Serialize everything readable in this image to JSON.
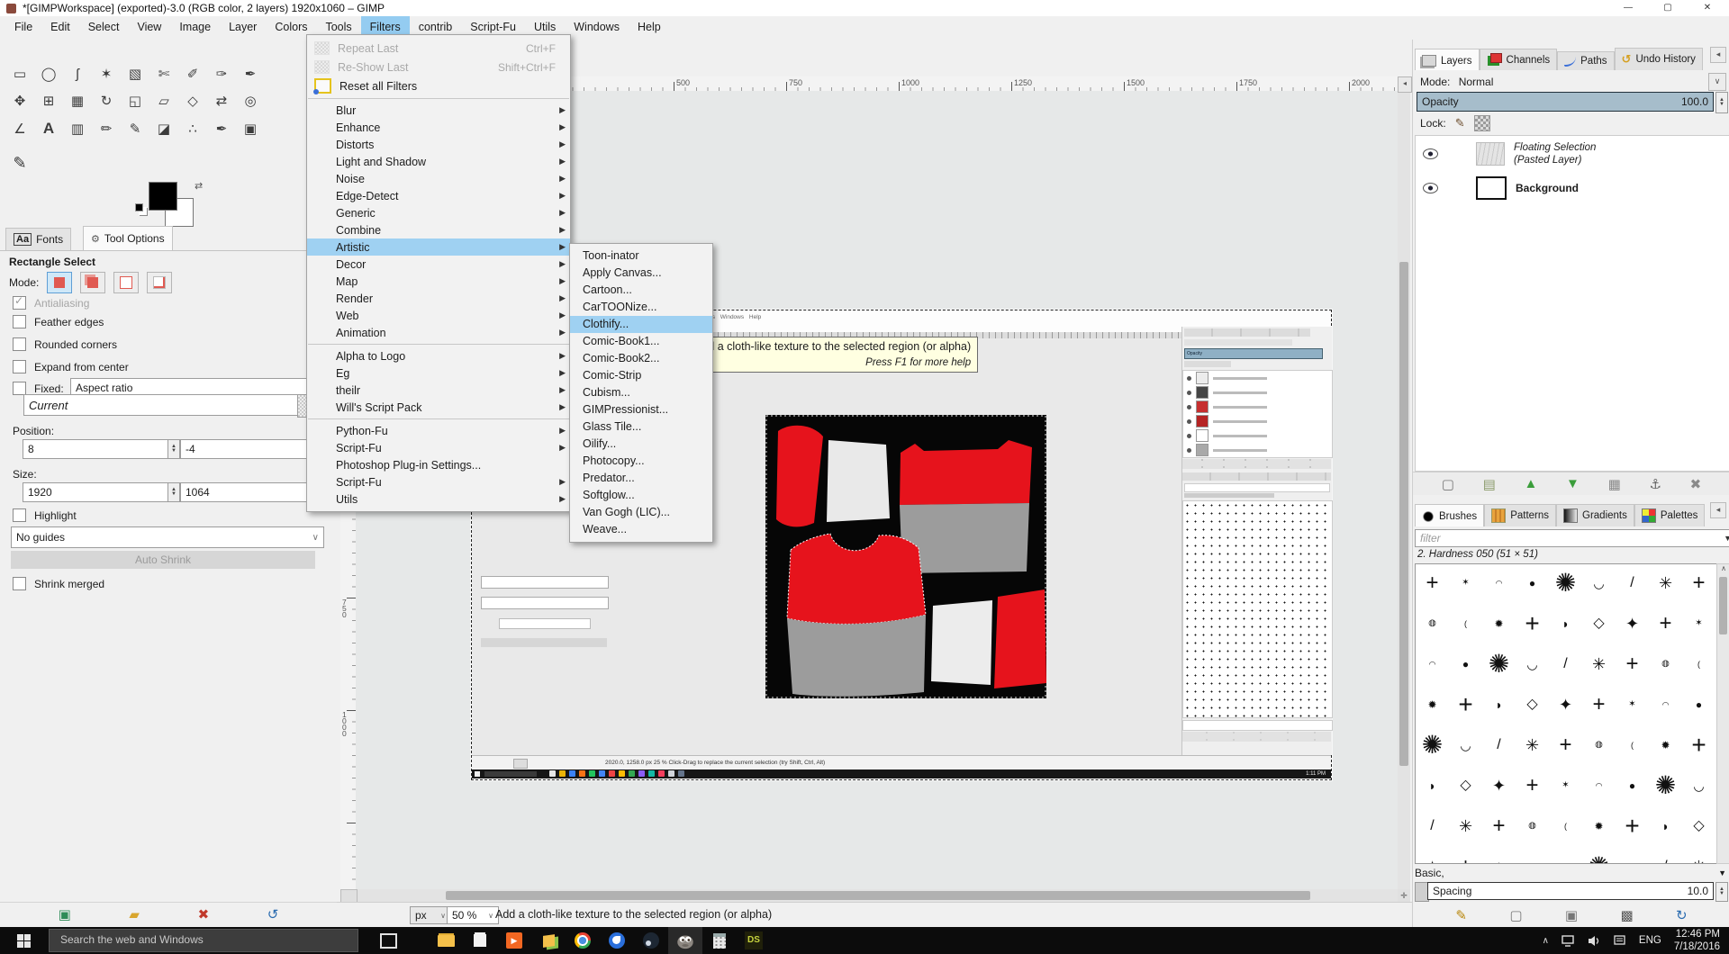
{
  "titlebar": {
    "title": "*[GIMPWorkspace] (exported)-3.0 (RGB color, 2 layers) 1920x1060 – GIMP",
    "buttons": {
      "minimize": "—",
      "maximize": "▢",
      "close": "✕"
    }
  },
  "menubar": {
    "items": [
      "File",
      "Edit",
      "Select",
      "View",
      "Image",
      "Layer",
      "Colors",
      "Tools",
      "Filters",
      "contrib",
      "Script-Fu",
      "Utils",
      "Windows",
      "Help"
    ],
    "active_index": 8
  },
  "filters_menu": {
    "items": [
      {
        "label": "Repeat Last",
        "shortcut": "Ctrl+F",
        "disabled": true,
        "icon": "pattern",
        "tall": true
      },
      {
        "label": "Re-Show Last",
        "shortcut": "Shift+Ctrl+F",
        "disabled": true,
        "icon": "pattern",
        "tall": true
      },
      {
        "label": "Reset all Filters",
        "icon": "reset",
        "tall": true
      },
      {
        "sep": true
      },
      {
        "label": "Blur",
        "sub": true
      },
      {
        "label": "Enhance",
        "sub": true
      },
      {
        "label": "Distorts",
        "sub": true
      },
      {
        "label": "Light and Shadow",
        "sub": true
      },
      {
        "label": "Noise",
        "sub": true
      },
      {
        "label": "Edge-Detect",
        "sub": true
      },
      {
        "label": "Generic",
        "sub": true
      },
      {
        "label": "Combine",
        "sub": true
      },
      {
        "label": "Artistic",
        "sub": true,
        "hl": true
      },
      {
        "label": "Decor",
        "sub": true
      },
      {
        "label": "Map",
        "sub": true
      },
      {
        "label": "Render",
        "sub": true
      },
      {
        "label": "Web",
        "sub": true
      },
      {
        "label": "Animation",
        "sub": true
      },
      {
        "sep": true
      },
      {
        "label": "Alpha to Logo",
        "sub": true
      },
      {
        "label": "Eg",
        "sub": true
      },
      {
        "label": "theilr",
        "sub": true
      },
      {
        "label": "Will's Script Pack",
        "sub": true
      },
      {
        "sep": true
      },
      {
        "label": "Python-Fu",
        "sub": true
      },
      {
        "label": "Script-Fu",
        "sub": true
      },
      {
        "label": "Photoshop Plug-in Settings..."
      },
      {
        "label": "Script-Fu",
        "sub": true
      },
      {
        "label": "Utils",
        "sub": true
      }
    ]
  },
  "artistic_submenu": {
    "highlighted": "Clothify...",
    "items": [
      "Toon-inator",
      "Apply Canvas...",
      "Cartoon...",
      "CarTOONize...",
      "Clothify...",
      "Comic-Book1...",
      "Comic-Book2...",
      "Comic-Strip",
      "Cubism...",
      "GIMPressionist...",
      "Glass Tile...",
      "Oilify...",
      "Photocopy...",
      "Predator...",
      "Softglow...",
      "Van Gogh (LIC)...",
      "Weave..."
    ]
  },
  "tooltip": {
    "line1": "Add a cloth-like texture to the selected region (or alpha)",
    "line2": "Press F1 for more help"
  },
  "toolbox": {
    "tools": [
      {
        "name": "rectangle-select",
        "glyph": "▭"
      },
      {
        "name": "ellipse-select",
        "glyph": "◯"
      },
      {
        "name": "free-select",
        "glyph": "ʃ"
      },
      {
        "name": "fuzzy-select",
        "glyph": "✶"
      },
      {
        "name": "select-by-color",
        "glyph": "▧"
      },
      {
        "name": "scissors-select",
        "glyph": "✄"
      },
      {
        "name": "foreground-select",
        "glyph": "✐"
      },
      {
        "name": "paths",
        "glyph": "✑"
      },
      {
        "name": "color-picker",
        "glyph": "✒"
      },
      {
        "name": "move",
        "glyph": "✥"
      },
      {
        "name": "alignment",
        "glyph": "⊞"
      },
      {
        "name": "crop",
        "glyph": "▦"
      },
      {
        "name": "rotate",
        "glyph": "↻"
      },
      {
        "name": "scale",
        "glyph": "◱"
      },
      {
        "name": "shear",
        "glyph": "▱"
      },
      {
        "name": "perspective",
        "glyph": "◇"
      },
      {
        "name": "flip",
        "glyph": "⇄"
      },
      {
        "name": "zoom",
        "glyph": "◎"
      },
      {
        "name": "measure",
        "glyph": "∠"
      },
      {
        "name": "text",
        "glyph": "A"
      },
      {
        "name": "gradient",
        "glyph": "▥"
      },
      {
        "name": "pencil",
        "glyph": "✏"
      },
      {
        "name": "paintbrush",
        "glyph": "✎"
      },
      {
        "name": "eraser",
        "glyph": "◪"
      },
      {
        "name": "airbrush",
        "glyph": "∴"
      },
      {
        "name": "ink",
        "glyph": "✒"
      },
      {
        "name": "clone",
        "glyph": "▣"
      }
    ],
    "paint_tool_glyph": "✎"
  },
  "tool_options": {
    "fonts_tab_icon": "Aa",
    "fonts_tab": "Fonts",
    "tool_options_tab": "Tool Options",
    "title": "Rectangle Select",
    "mode_label": "Mode:",
    "antialiasing_label": "Antialiasing",
    "feather_label": "Feather edges",
    "rounded_label": "Rounded corners",
    "expand_label": "Expand from center",
    "fixed_label": "Fixed:",
    "fixed_value": "Aspect ratio",
    "current_value": "Current",
    "position_label": "Position:",
    "position_x": "8",
    "position_y": "-4",
    "size_label": "Size:",
    "size_w": "1920",
    "size_h": "1064",
    "highlight_label": "Highlight",
    "guides_value": "No guides",
    "auto_shrink_label": "Auto Shrink",
    "shrink_merged_label": "Shrink merged"
  },
  "left_dock_footer": {
    "icons": [
      {
        "name": "save-preset-icon",
        "glyph": "▣",
        "color": "#2e8b57"
      },
      {
        "name": "open-folder-icon",
        "glyph": "▰",
        "color": "#d9a62e"
      },
      {
        "name": "delete-preset-icon",
        "glyph": "✖",
        "color": "#c0392b"
      },
      {
        "name": "reset-tool-icon",
        "glyph": "↺",
        "color": "#2b6cb0"
      }
    ]
  },
  "canvas": {
    "h_ruler_labels": [
      500,
      750,
      1000,
      1250,
      1500,
      1750,
      2000
    ],
    "v_ruler_labels": [
      750,
      1000
    ],
    "statusbar": {
      "unit": "px",
      "zoom": "50 %",
      "message": "Add a cloth-like texture to the selected region (or alpha)"
    }
  },
  "inner_screenshot": {
    "menu_text": "File   Edit   Select   View   Image   Layer   Colors   Tools   Filters   contrib   Script-Fu   Utils   Windows   Help",
    "status_text": "2020.0, 1258.0      px      25 %      Click-Drag to replace the current selection (try Shift, Ctrl, Alt)",
    "clock": "1:11 PM",
    "taskbar_colors": [
      "#e6e6e6",
      "#eab308",
      "#3b82f6",
      "#f97316",
      "#22c55e",
      "#4285f4",
      "#ef4444",
      "#fbbc05",
      "#34a853",
      "#8b5cf6",
      "#14b8a6",
      "#f43f5e",
      "#d1d5db",
      "#64748b"
    ],
    "layer_thumbs": [
      "#ececec",
      "#454545",
      "#c62f2f",
      "#b52424",
      "#ffffff",
      "#a9a9a9"
    ]
  },
  "layers_panel": {
    "tabs": [
      "Layers",
      "Channels",
      "Paths",
      "Undo History"
    ],
    "mode_label": "Mode:",
    "mode_value": "Normal",
    "opacity_label": "Opacity",
    "opacity_value": "100.0",
    "lock_label": "Lock:",
    "layer1_line1": "Floating Selection",
    "layer1_line2": "(Pasted Layer)",
    "layer2": "Background",
    "footer_icons": [
      {
        "name": "new-layer-icon",
        "glyph": "▢",
        "color": "#777777"
      },
      {
        "name": "new-group-icon",
        "glyph": "▤",
        "color": "#8a9a6a"
      },
      {
        "name": "raise-layer-icon",
        "glyph": "▲",
        "color": "#3a9d3a"
      },
      {
        "name": "lower-layer-icon",
        "glyph": "▼",
        "color": "#3a9d3a"
      },
      {
        "name": "duplicate-layer-icon",
        "glyph": "▦",
        "color": "#888888"
      },
      {
        "name": "anchor-layer-icon",
        "glyph": "⚓",
        "color": "#666666"
      },
      {
        "name": "delete-layer-icon",
        "glyph": "✖",
        "color": "#8a8a8a"
      }
    ]
  },
  "brushes_panel": {
    "tabs": [
      "Brushes",
      "Patterns",
      "Gradients",
      "Palettes"
    ],
    "filter_placeholder": "filter",
    "brush_name": "2. Hardness 050 (51 × 51)",
    "category": "Basic,",
    "spacing_label": "Spacing",
    "spacing_value": "10.0",
    "grid_glyphs": [
      "+",
      "✶",
      "◠",
      "●",
      "✺",
      "◡",
      "/",
      "✳",
      "+",
      "◍",
      "(",
      "✹",
      "+",
      "◗",
      "◇",
      "✦"
    ],
    "grid_sizes": [
      10,
      16,
      12,
      24,
      14,
      9,
      18,
      28
    ],
    "footer_icons": [
      {
        "name": "edit-brush-icon",
        "glyph": "✎",
        "color": "#b8860b"
      },
      {
        "name": "new-brush-icon",
        "glyph": "▢",
        "color": "#777777"
      },
      {
        "name": "duplicate-brush-icon",
        "glyph": "▣",
        "color": "#777777"
      },
      {
        "name": "delete-brush-icon",
        "glyph": "▩",
        "color": "#555555"
      },
      {
        "name": "refresh-brushes-icon",
        "glyph": "↻",
        "color": "#2b6cb0"
      }
    ]
  },
  "taskbar": {
    "search_placeholder": "Search the web and Windows",
    "ds_label": "DS",
    "tray_lang": "ENG",
    "tray_time": "12:46 PM",
    "tray_date": "7/18/2016"
  }
}
